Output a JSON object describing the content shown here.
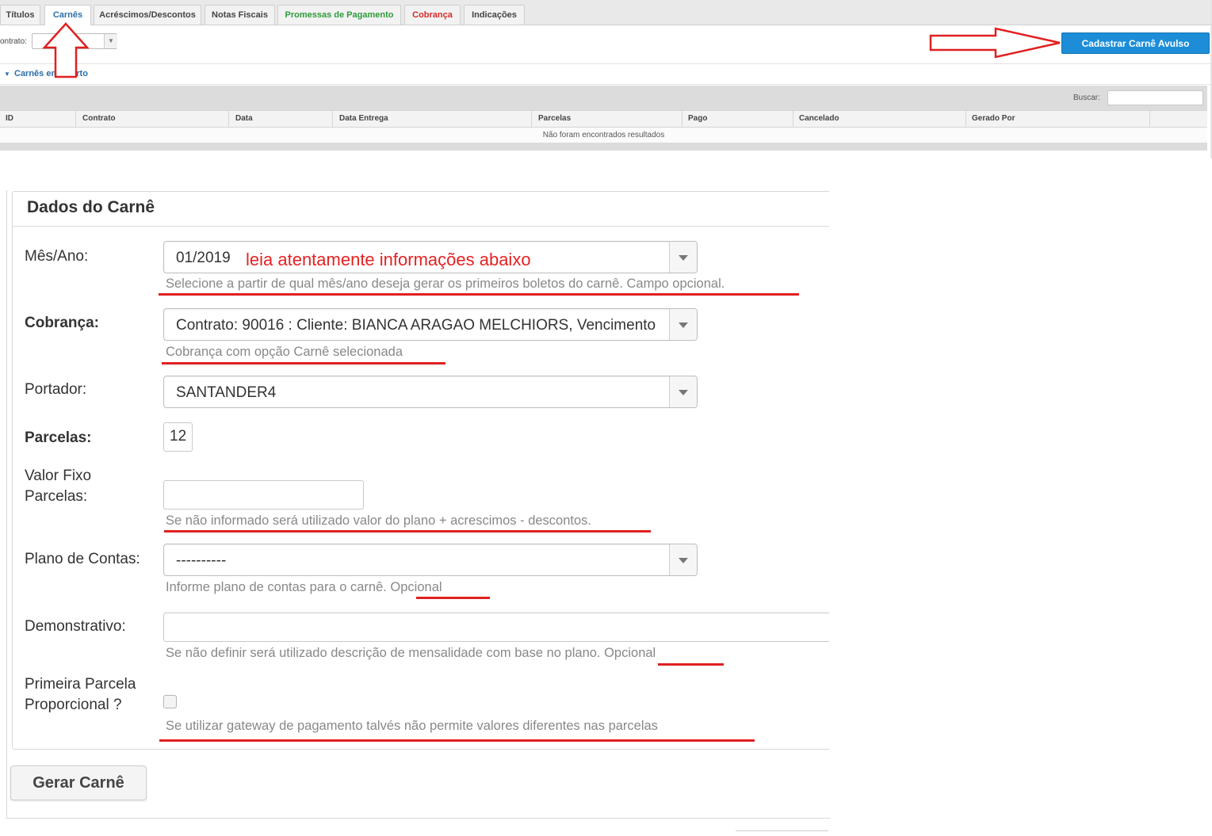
{
  "tabs": [
    {
      "label": "Títulos"
    },
    {
      "label": "Carnês"
    },
    {
      "label": "Acréscimos/Descontos"
    },
    {
      "label": "Notas Fiscais"
    },
    {
      "label": "Promessas de Pagamento"
    },
    {
      "label": "Cobrança"
    },
    {
      "label": "Indicações"
    }
  ],
  "filter": {
    "contract_label": "ontrato:",
    "contract_value": ""
  },
  "toolbar": {
    "register_button": "Cadastrar Carnê Avulso"
  },
  "section": {
    "title": "Carnês em aberto"
  },
  "table": {
    "search_label": "Buscar:",
    "columns": [
      "ID",
      "Contrato",
      "Data",
      "Data Entrega",
      "Parcelas",
      "Pago",
      "Cancelado",
      "Gerado Por"
    ],
    "empty_message": "Não foram encontrados resultados"
  },
  "form": {
    "legend": "Dados do Carnê",
    "mes_ano": {
      "label": "Mês/Ano:",
      "value": "01/2019",
      "annotation": "leia atentamente informações abaixo",
      "help": "Selecione a partir de qual mês/ano deseja gerar os primeiros boletos do carnê. Campo opcional."
    },
    "cobranca": {
      "label": "Cobrança:",
      "value": "Contrato: 90016 : Cliente: BIANCA ARAGAO MELCHIORS, Vencimento",
      "help": "Cobrança com opção Carnê selecionada"
    },
    "portador": {
      "label": "Portador:",
      "value": "SANTANDER4"
    },
    "parcelas": {
      "label": "Parcelas:",
      "value": "12"
    },
    "valor_fixo": {
      "label_line1": "Valor Fixo",
      "label_line2": "Parcelas:",
      "value": "",
      "help": "Se não informado será utilizado valor do plano + acrescimos - descontos."
    },
    "plano_contas": {
      "label": "Plano de Contas:",
      "value": "----------",
      "help": "Informe plano de contas para o carnê. Opcional"
    },
    "demonstrativo": {
      "label": "Demonstrativo:",
      "value": "",
      "help": "Se não definir será utilizado descrição de mensalidade com base no plano. Opcional"
    },
    "primeira_parcela": {
      "label_line1": "Primeira Parcela",
      "label_line2": "Proporcional ?",
      "help": "Se utilizar gateway de pagamento talvés não permite valores diferentes nas parcelas"
    },
    "submit_label": "Gerar Carnê"
  },
  "colors": {
    "accent_blue": "#1d8dd8",
    "annotation_red": "#e02020",
    "tab_green": "#2d9b3a",
    "tab_red": "#d62b2b"
  }
}
